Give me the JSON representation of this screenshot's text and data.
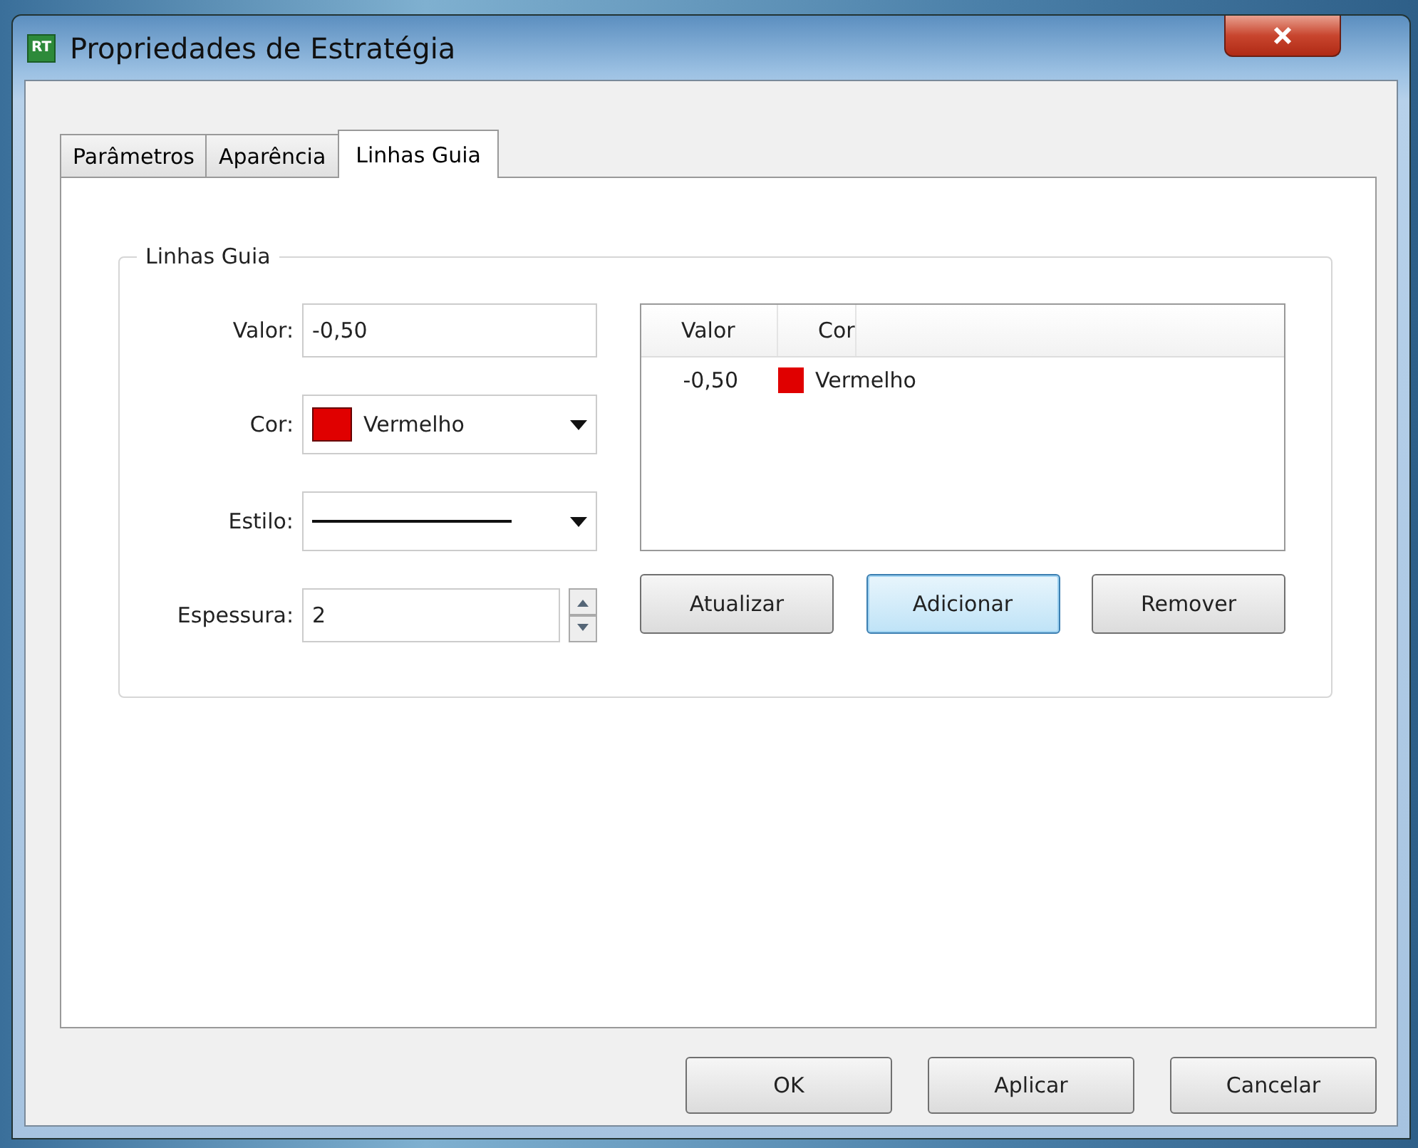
{
  "window": {
    "app_icon": "RT",
    "title": "Propriedades de Estratégia"
  },
  "tabs": [
    {
      "label": "Parâmetros",
      "selected": false
    },
    {
      "label": "Aparência",
      "selected": false
    },
    {
      "label": "Linhas Guia",
      "selected": true
    }
  ],
  "group": {
    "legend": "Linhas Guia",
    "fields": [
      {
        "kind": "text",
        "label": "Valor:",
        "value": "-0,50"
      },
      {
        "kind": "color",
        "label": "Cor:",
        "value": "Vermelho",
        "color": "#e00000"
      },
      {
        "kind": "line",
        "label": "Estilo:"
      },
      {
        "kind": "spin",
        "label": "Espessura:",
        "value": "2"
      }
    ],
    "list": {
      "columns": [
        "Valor",
        "Cor"
      ],
      "rows": [
        {
          "valor": "-0,50",
          "cor": "Vermelho",
          "color": "#e00000"
        }
      ]
    },
    "buttons": [
      {
        "label": "Atualizar",
        "focused": false
      },
      {
        "label": "Adicionar",
        "focused": true
      },
      {
        "label": "Remover",
        "focused": false
      }
    ]
  },
  "footer_buttons": [
    "OK",
    "Aplicar",
    "Cancelar"
  ]
}
